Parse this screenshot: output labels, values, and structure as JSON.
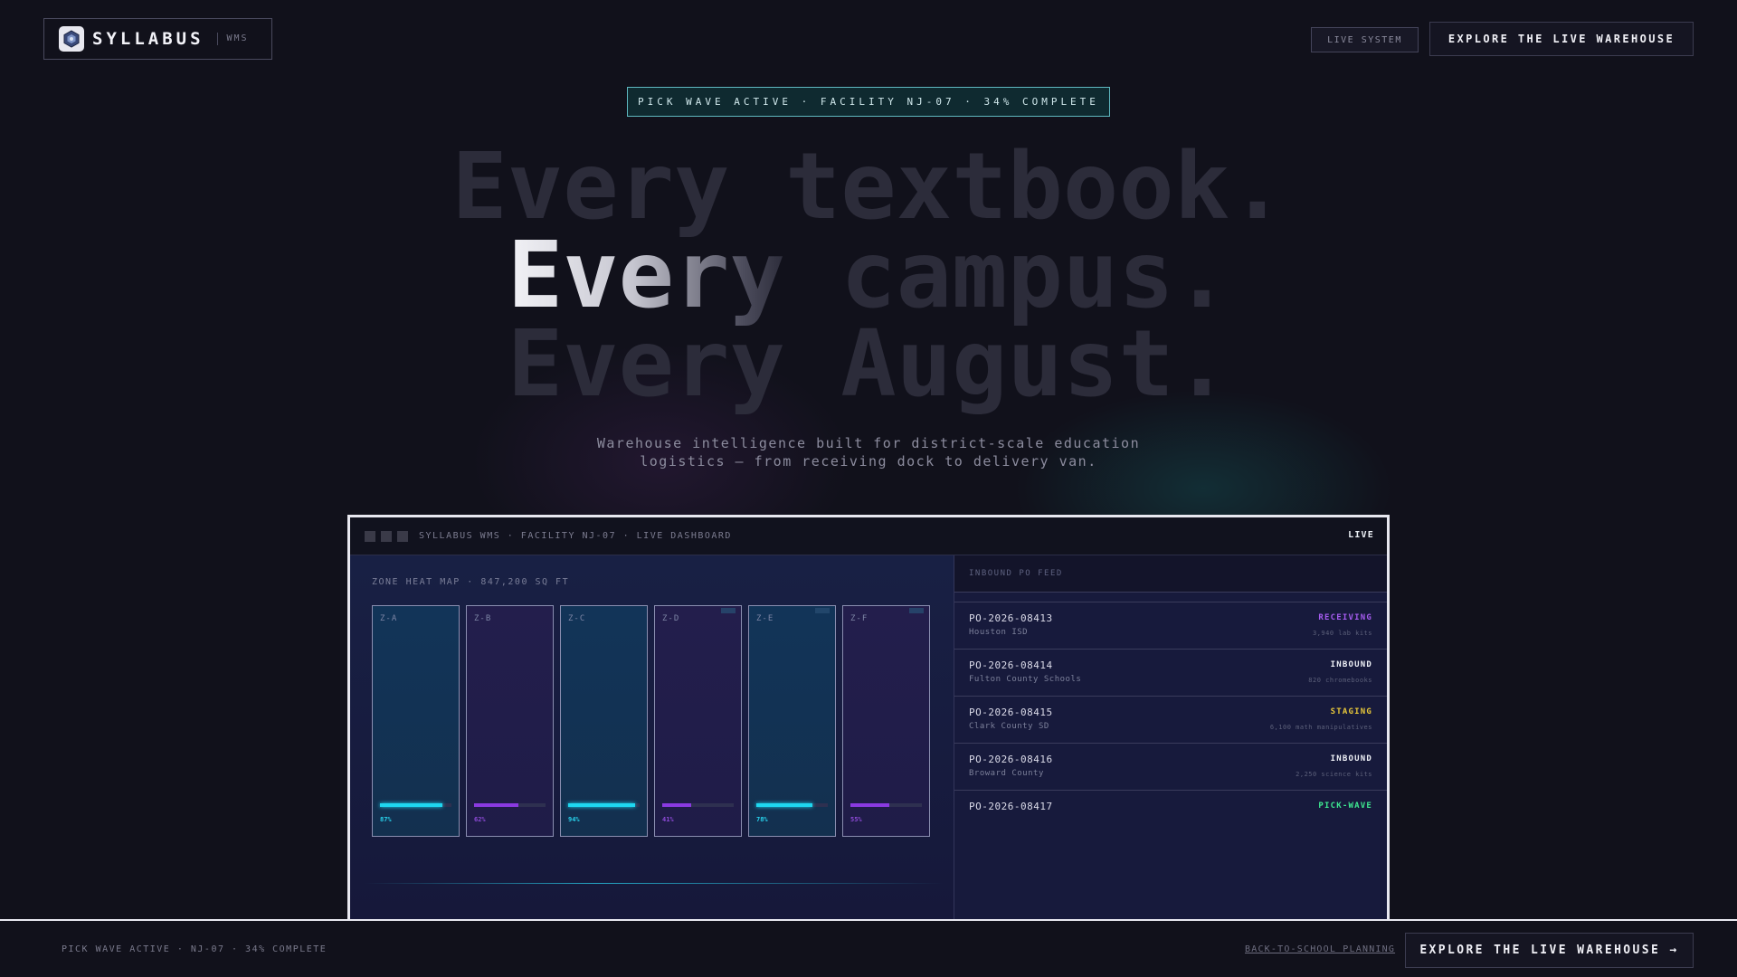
{
  "header": {
    "logo_text": "SYLLABUS",
    "logo_sub": "WMS",
    "logo_icon": "cube-icon",
    "live_system_label": "LIVE SYSTEM",
    "explore_label": "EXPLORE THE LIVE WAREHOUSE"
  },
  "banner": {
    "text": "PICK WAVE ACTIVE · FACILITY NJ-07 · 34% COMPLETE"
  },
  "hero": {
    "line1": "Every textbook.",
    "line2_highlight": "Every",
    "line2_rest": " campus.",
    "line3": "Every August.",
    "subtitle_line1": "Warehouse intelligence built for district-scale education",
    "subtitle_line2": "logistics — from receiving dock to delivery van."
  },
  "dashboard": {
    "title": "SYLLABUS WMS · FACILITY NJ-07 · LIVE DASHBOARD",
    "live_label": "LIVE",
    "heat_map_title": "ZONE HEAT MAP · 847,200 SQ FT",
    "zones": [
      {
        "label": "Z-A",
        "percent": 87,
        "percent_label": "87%",
        "color": "cyan",
        "badge": false
      },
      {
        "label": "Z-B",
        "percent": 62,
        "percent_label": "62%",
        "color": "purple",
        "badge": false
      },
      {
        "label": "Z-C",
        "percent": 94,
        "percent_label": "94%",
        "color": "cyan",
        "badge": false
      },
      {
        "label": "Z-D",
        "percent": 41,
        "percent_label": "41%",
        "color": "purple",
        "badge": true
      },
      {
        "label": "Z-E",
        "percent": 78,
        "percent_label": "78%",
        "color": "cyan",
        "badge": true
      },
      {
        "label": "Z-F",
        "percent": 55,
        "percent_label": "55%",
        "color": "purple",
        "badge": true
      }
    ],
    "feed_title": "INBOUND PO FEED",
    "feed": [
      {
        "id": "PO-2026-08413",
        "org": "Houston ISD",
        "status": "RECEIVING",
        "status_color": "#a65cf0",
        "detail": "3,940 lab kits"
      },
      {
        "id": "PO-2026-08414",
        "org": "Fulton County Schools",
        "status": "INBOUND",
        "status_color": "#f0f2f8",
        "detail": "820 chromebooks"
      },
      {
        "id": "PO-2026-08415",
        "org": "Clark County SD",
        "status": "STAGING",
        "status_color": "#e8c83a",
        "detail": "6,100 math manipulatives"
      },
      {
        "id": "PO-2026-08416",
        "org": "Broward County",
        "status": "INBOUND",
        "status_color": "#f0f2f8",
        "detail": "2,250 science kits"
      },
      {
        "id": "PO-2026-08417",
        "org": "",
        "status": "PICK-WAVE",
        "status_color": "#3ee890",
        "detail": ""
      }
    ]
  },
  "footer": {
    "status_text": "PICK WAVE ACTIVE · NJ-07 · 34% COMPLETE",
    "link_text": "BACK-TO-SCHOOL PLANNING",
    "button_label": "EXPLORE THE LIVE WAREHOUSE →"
  },
  "colors": {
    "background": "#11111b",
    "accent_cyan": "#1ed7f0",
    "accent_purple": "#8a3ae0",
    "banner_border": "#5fb8c0"
  }
}
